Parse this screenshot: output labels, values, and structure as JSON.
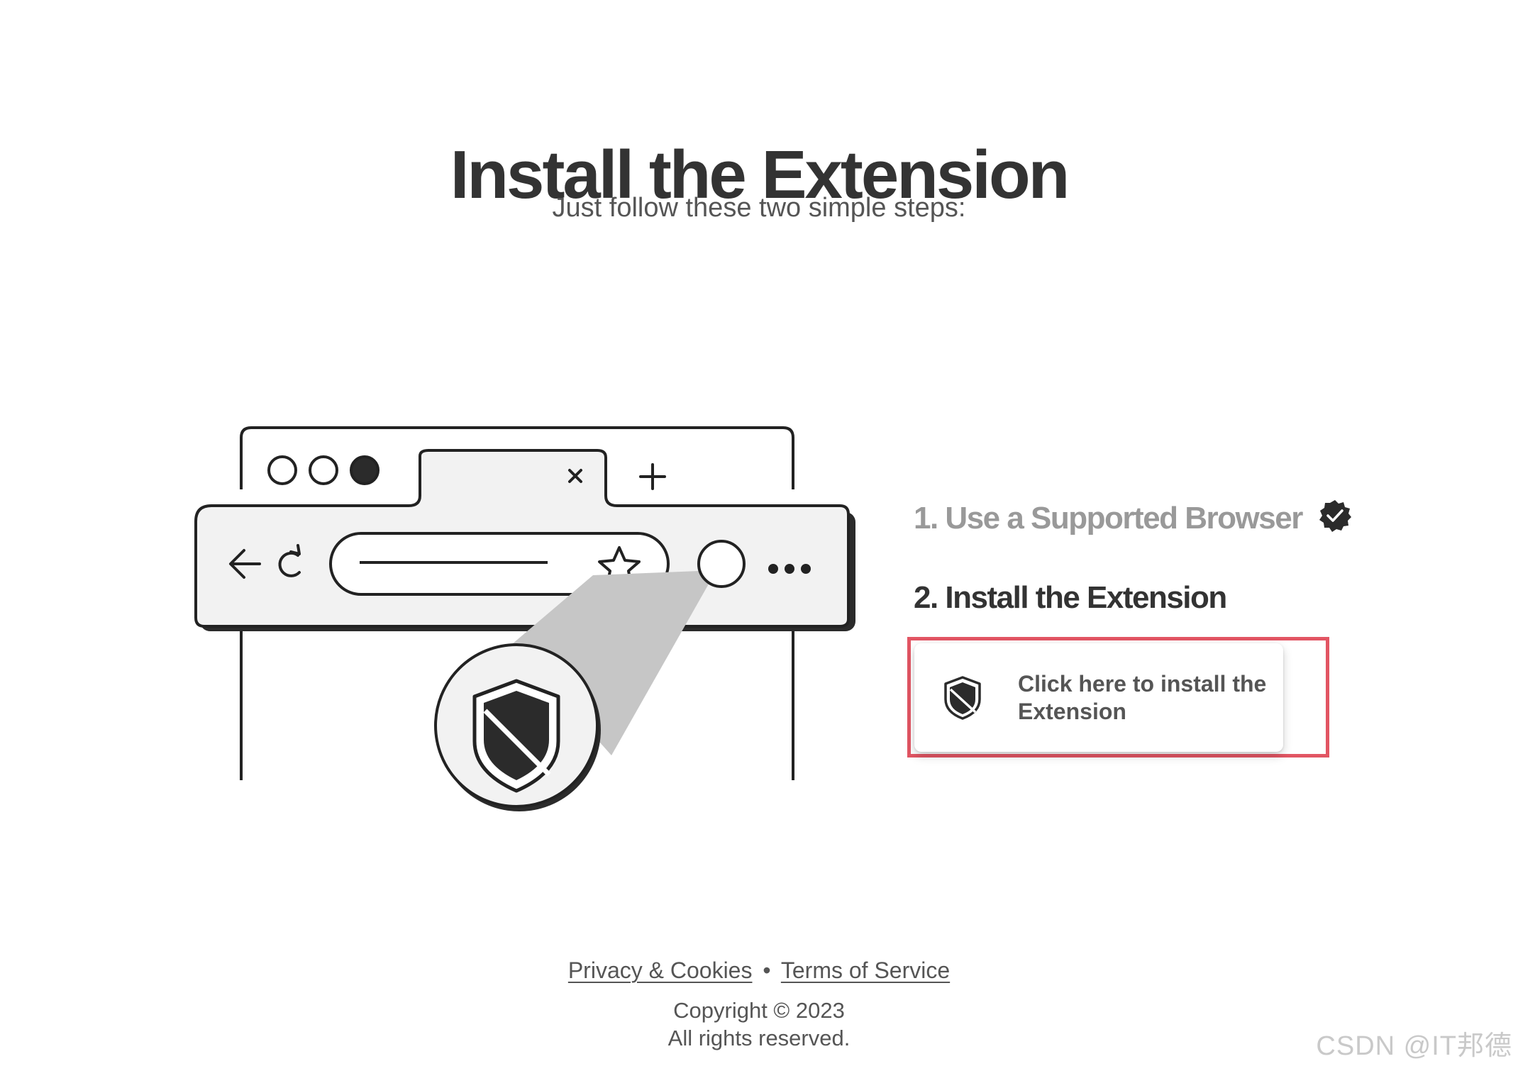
{
  "header": {
    "title": "Install the Extension",
    "subtitle": "Just follow these two simple steps:"
  },
  "steps": [
    {
      "label": "1. Use a Supported Browser",
      "state": "completed",
      "icon": "verified-check-icon"
    },
    {
      "label": "2. Install the Extension",
      "state": "current"
    }
  ],
  "install_button": {
    "label": "Click here to install the Extension",
    "icon": "shield-icon"
  },
  "footer": {
    "privacy_link": "Privacy & Cookies",
    "separator": "•",
    "terms_link": "Terms of Service",
    "copyright_line1": "Copyright © 2023",
    "copyright_line2": "All rights reserved."
  },
  "watermark": "CSDN @IT邦德",
  "colors": {
    "title": "#333333",
    "step_done": "#999999",
    "highlight": "#e25563",
    "icon_dark": "#2b2b2b",
    "illustration_fill": "#f2f2f2"
  }
}
